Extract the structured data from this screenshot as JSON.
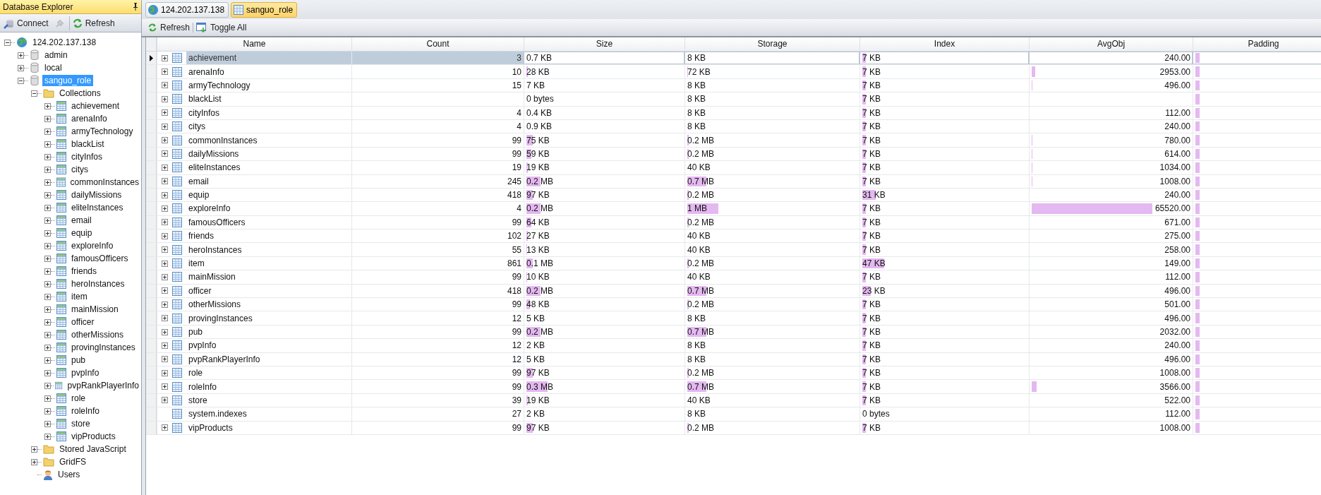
{
  "explorer": {
    "title": "Database Explorer",
    "toolbar": [
      {
        "kind": "connect",
        "label": "Connect"
      },
      {
        "kind": "disconnect",
        "disabled": true
      },
      {
        "kind": "refresh",
        "label": "Refresh"
      }
    ],
    "tree": [
      {
        "label": "124.202.137.138",
        "kind": "server",
        "expanded": true,
        "selected": false,
        "children": [
          {
            "label": "admin",
            "kind": "database",
            "expanded": false,
            "selected": false
          },
          {
            "label": "local",
            "kind": "database",
            "expanded": false,
            "selected": false
          },
          {
            "label": "sanguo_role",
            "kind": "database",
            "expanded": true,
            "selected": true,
            "children": [
              {
                "label": "Collections",
                "kind": "folder",
                "expanded": true,
                "selected": false,
                "children": [
                  {
                    "label": "achievement",
                    "kind": "collection",
                    "expanded": false,
                    "selected": false
                  },
                  {
                    "label": "arenaInfo",
                    "kind": "collection",
                    "expanded": false,
                    "selected": false
                  },
                  {
                    "label": "armyTechnology",
                    "kind": "collection",
                    "expanded": false,
                    "selected": false
                  },
                  {
                    "label": "blackList",
                    "kind": "collection",
                    "expanded": false,
                    "selected": false
                  },
                  {
                    "label": "cityInfos",
                    "kind": "collection",
                    "expanded": false,
                    "selected": false
                  },
                  {
                    "label": "citys",
                    "kind": "collection",
                    "expanded": false,
                    "selected": false
                  },
                  {
                    "label": "commonInstances",
                    "kind": "collection",
                    "expanded": false,
                    "selected": false
                  },
                  {
                    "label": "dailyMissions",
                    "kind": "collection",
                    "expanded": false,
                    "selected": false
                  },
                  {
                    "label": "eliteInstances",
                    "kind": "collection",
                    "expanded": false,
                    "selected": false
                  },
                  {
                    "label": "email",
                    "kind": "collection",
                    "expanded": false,
                    "selected": false
                  },
                  {
                    "label": "equip",
                    "kind": "collection",
                    "expanded": false,
                    "selected": false
                  },
                  {
                    "label": "exploreInfo",
                    "kind": "collection",
                    "expanded": false,
                    "selected": false
                  },
                  {
                    "label": "famousOfficers",
                    "kind": "collection",
                    "expanded": false,
                    "selected": false
                  },
                  {
                    "label": "friends",
                    "kind": "collection",
                    "expanded": false,
                    "selected": false
                  },
                  {
                    "label": "heroInstances",
                    "kind": "collection",
                    "expanded": false,
                    "selected": false
                  },
                  {
                    "label": "item",
                    "kind": "collection",
                    "expanded": false,
                    "selected": false
                  },
                  {
                    "label": "mainMission",
                    "kind": "collection",
                    "expanded": false,
                    "selected": false
                  },
                  {
                    "label": "officer",
                    "kind": "collection",
                    "expanded": false,
                    "selected": false
                  },
                  {
                    "label": "otherMissions",
                    "kind": "collection",
                    "expanded": false,
                    "selected": false
                  },
                  {
                    "label": "provingInstances",
                    "kind": "collection",
                    "expanded": false,
                    "selected": false
                  },
                  {
                    "label": "pub",
                    "kind": "collection",
                    "expanded": false,
                    "selected": false
                  },
                  {
                    "label": "pvpInfo",
                    "kind": "collection",
                    "expanded": false,
                    "selected": false
                  },
                  {
                    "label": "pvpRankPlayerInfo",
                    "kind": "collection",
                    "expanded": false,
                    "selected": false
                  },
                  {
                    "label": "role",
                    "kind": "collection",
                    "expanded": false,
                    "selected": false
                  },
                  {
                    "label": "roleInfo",
                    "kind": "collection",
                    "expanded": false,
                    "selected": false
                  },
                  {
                    "label": "store",
                    "kind": "collection",
                    "expanded": false,
                    "selected": false
                  },
                  {
                    "label": "vipProducts",
                    "kind": "collection",
                    "expanded": false,
                    "selected": false
                  }
                ]
              },
              {
                "label": "Stored JavaScript",
                "kind": "folder",
                "expanded": false,
                "selected": false
              },
              {
                "label": "GridFS",
                "kind": "folder",
                "expanded": false,
                "selected": false
              },
              {
                "label": "Users",
                "kind": "user",
                "selected": false
              }
            ]
          }
        ]
      }
    ]
  },
  "tabs": [
    {
      "label": "124.202.137.138",
      "kind": "server",
      "selected": false
    },
    {
      "label": "sanguo_role",
      "kind": "database",
      "selected": true
    }
  ],
  "toolbar": [
    {
      "kind": "refresh",
      "label": "Refresh"
    },
    {
      "kind": "toggle",
      "label": "Toggle All"
    }
  ],
  "table": {
    "columns": [
      "Name",
      "Count",
      "Size",
      "Storage",
      "Index",
      "AvgObj",
      "Padding"
    ],
    "rows": [
      {
        "name": "achievement",
        "expandable": true,
        "selected": true,
        "count": "3",
        "size": {
          "text": "0.7 KB"
        },
        "storage": {
          "text": "8 KB"
        },
        "index": {
          "text": "7 KB",
          "level": 0.02
        },
        "avgobj": {
          "text": "240.00"
        },
        "padding": {
          "level": 0.03
        }
      },
      {
        "name": "arenaInfo",
        "expandable": true,
        "selected": false,
        "count": "10",
        "size": {
          "text": "28 KB",
          "level": 0.01
        },
        "storage": {
          "text": "72 KB",
          "level": 0.005
        },
        "index": {
          "text": "7 KB",
          "level": 0.02
        },
        "avgobj": {
          "text": "2953.00",
          "level": 0.02
        },
        "padding": {
          "level": 0.03
        }
      },
      {
        "name": "armyTechnology",
        "expandable": true,
        "selected": false,
        "count": "15",
        "size": {
          "text": "7 KB"
        },
        "storage": {
          "text": "8 KB"
        },
        "index": {
          "text": "7 KB",
          "level": 0.02
        },
        "avgobj": {
          "text": "496.00",
          "level": 0.005
        },
        "padding": {
          "level": 0.03
        }
      },
      {
        "name": "blackList",
        "expandable": true,
        "selected": false,
        "size": {
          "text": "0 bytes"
        },
        "storage": {
          "text": "8 KB"
        },
        "index": {
          "text": "7 KB",
          "level": 0.02
        },
        "padding": {
          "level": 0.03
        }
      },
      {
        "name": "cityInfos",
        "expandable": true,
        "selected": false,
        "count": "4",
        "size": {
          "text": "0.4 KB"
        },
        "storage": {
          "text": "8 KB"
        },
        "index": {
          "text": "7 KB",
          "level": 0.02
        },
        "avgobj": {
          "text": "112.00"
        },
        "padding": {
          "level": 0.03
        }
      },
      {
        "name": "citys",
        "expandable": true,
        "selected": false,
        "count": "4",
        "size": {
          "text": "0.9 KB"
        },
        "storage": {
          "text": "8 KB"
        },
        "index": {
          "text": "7 KB",
          "level": 0.02
        },
        "avgobj": {
          "text": "240.00"
        },
        "padding": {
          "level": 0.03
        }
      },
      {
        "name": "commonInstances",
        "expandable": true,
        "selected": false,
        "count": "99",
        "size": {
          "text": "75 KB",
          "level": 0.04
        },
        "storage": {
          "text": "0.2 MB",
          "level": 0.01
        },
        "index": {
          "text": "7 KB",
          "level": 0.02
        },
        "avgobj": {
          "text": "780.00",
          "level": 0.005
        },
        "padding": {
          "level": 0.03
        }
      },
      {
        "name": "dailyMissions",
        "expandable": true,
        "selected": false,
        "count": "99",
        "size": {
          "text": "59 KB",
          "level": 0.03
        },
        "storage": {
          "text": "0.2 MB",
          "level": 0.01
        },
        "index": {
          "text": "7 KB",
          "level": 0.02
        },
        "avgobj": {
          "text": "614.00",
          "level": 0.005
        },
        "padding": {
          "level": 0.03
        }
      },
      {
        "name": "eliteInstances",
        "expandable": true,
        "selected": false,
        "count": "19",
        "size": {
          "text": "19 KB",
          "level": 0.01
        },
        "storage": {
          "text": "40 KB"
        },
        "index": {
          "text": "7 KB",
          "level": 0.02
        },
        "avgobj": {
          "text": "1034.00",
          "level": 0.005
        },
        "padding": {
          "level": 0.03
        }
      },
      {
        "name": "email",
        "expandable": true,
        "selected": false,
        "count": "245",
        "size": {
          "text": "0.2 MB",
          "level": 0.09
        },
        "storage": {
          "text": "0.7 MB",
          "level": 0.11
        },
        "index": {
          "text": "7 KB",
          "level": 0.02
        },
        "avgobj": {
          "text": "1008.00",
          "level": 0.005
        },
        "padding": {
          "level": 0.03
        }
      },
      {
        "name": "equip",
        "expandable": true,
        "selected": false,
        "count": "418",
        "size": {
          "text": "97 KB",
          "level": 0.04
        },
        "storage": {
          "text": "0.2 MB",
          "level": 0.01
        },
        "index": {
          "text": "31 KB",
          "level": 0.08
        },
        "avgobj": {
          "text": "240.00"
        },
        "padding": {
          "level": 0.03
        }
      },
      {
        "name": "exploreInfo",
        "expandable": true,
        "selected": false,
        "count": "4",
        "size": {
          "text": "0.2 MB",
          "level": 0.09
        },
        "storage": {
          "text": "1 MB",
          "level": 0.18
        },
        "index": {
          "text": "7 KB",
          "level": 0.02
        },
        "avgobj": {
          "text": "65520.00",
          "level": 0.74
        },
        "padding": {
          "level": 0.03
        }
      },
      {
        "name": "famousOfficers",
        "expandable": true,
        "selected": false,
        "count": "99",
        "size": {
          "text": "64 KB",
          "level": 0.03
        },
        "storage": {
          "text": "0.2 MB",
          "level": 0.01
        },
        "index": {
          "text": "7 KB",
          "level": 0.02
        },
        "avgobj": {
          "text": "671.00"
        },
        "padding": {
          "level": 0.03
        }
      },
      {
        "name": "friends",
        "expandable": true,
        "selected": false,
        "count": "102",
        "size": {
          "text": "27 KB",
          "level": 0.01
        },
        "storage": {
          "text": "40 KB"
        },
        "index": {
          "text": "7 KB",
          "level": 0.02
        },
        "avgobj": {
          "text": "275.00"
        },
        "padding": {
          "level": 0.03
        }
      },
      {
        "name": "heroInstances",
        "expandable": true,
        "selected": false,
        "count": "55",
        "size": {
          "text": "13 KB",
          "level": 0.005
        },
        "storage": {
          "text": "40 KB"
        },
        "index": {
          "text": "7 KB",
          "level": 0.02
        },
        "avgobj": {
          "text": "258.00"
        },
        "padding": {
          "level": 0.03
        }
      },
      {
        "name": "item",
        "expandable": true,
        "selected": false,
        "count": "861",
        "size": {
          "text": "0.1 MB",
          "level": 0.04
        },
        "storage": {
          "text": "0.2 MB",
          "level": 0.01
        },
        "index": {
          "text": "47 KB",
          "level": 0.13
        },
        "avgobj": {
          "text": "149.00"
        },
        "padding": {
          "level": 0.03
        }
      },
      {
        "name": "mainMission",
        "expandable": true,
        "selected": false,
        "count": "99",
        "size": {
          "text": "10 KB",
          "level": 0.005
        },
        "storage": {
          "text": "40 KB"
        },
        "index": {
          "text": "7 KB",
          "level": 0.02
        },
        "avgobj": {
          "text": "112.00"
        },
        "padding": {
          "level": 0.03
        }
      },
      {
        "name": "officer",
        "expandable": true,
        "selected": false,
        "count": "418",
        "size": {
          "text": "0.2 MB",
          "level": 0.09
        },
        "storage": {
          "text": "0.7 MB",
          "level": 0.11
        },
        "index": {
          "text": "23 KB",
          "level": 0.05
        },
        "avgobj": {
          "text": "496.00"
        },
        "padding": {
          "level": 0.03
        }
      },
      {
        "name": "otherMissions",
        "expandable": true,
        "selected": false,
        "count": "99",
        "size": {
          "text": "48 KB",
          "level": 0.02
        },
        "storage": {
          "text": "0.2 MB",
          "level": 0.01
        },
        "index": {
          "text": "7 KB",
          "level": 0.02
        },
        "avgobj": {
          "text": "501.00"
        },
        "padding": {
          "level": 0.03
        }
      },
      {
        "name": "provingInstances",
        "expandable": true,
        "selected": false,
        "count": "12",
        "size": {
          "text": "5 KB"
        },
        "storage": {
          "text": "8 KB"
        },
        "index": {
          "text": "7 KB",
          "level": 0.02
        },
        "avgobj": {
          "text": "496.00"
        },
        "padding": {
          "level": 0.03
        }
      },
      {
        "name": "pub",
        "expandable": true,
        "selected": false,
        "count": "99",
        "size": {
          "text": "0.2 MB",
          "level": 0.09
        },
        "storage": {
          "text": "0.7 MB",
          "level": 0.11
        },
        "index": {
          "text": "7 KB",
          "level": 0.02
        },
        "avgobj": {
          "text": "2032.00"
        },
        "padding": {
          "level": 0.03
        }
      },
      {
        "name": "pvpInfo",
        "expandable": true,
        "selected": false,
        "count": "12",
        "size": {
          "text": "2 KB"
        },
        "storage": {
          "text": "8 KB"
        },
        "index": {
          "text": "7 KB",
          "level": 0.02
        },
        "avgobj": {
          "text": "240.00"
        },
        "padding": {
          "level": 0.03
        }
      },
      {
        "name": "pvpRankPlayerInfo",
        "expandable": true,
        "selected": false,
        "count": "12",
        "size": {
          "text": "5 KB"
        },
        "storage": {
          "text": "8 KB"
        },
        "index": {
          "text": "7 KB",
          "level": 0.02
        },
        "avgobj": {
          "text": "496.00"
        },
        "padding": {
          "level": 0.03
        }
      },
      {
        "name": "role",
        "expandable": true,
        "selected": false,
        "count": "99",
        "size": {
          "text": "97 KB",
          "level": 0.04
        },
        "storage": {
          "text": "0.2 MB",
          "level": 0.01
        },
        "index": {
          "text": "7 KB",
          "level": 0.02
        },
        "avgobj": {
          "text": "1008.00"
        },
        "padding": {
          "level": 0.03
        }
      },
      {
        "name": "roleInfo",
        "expandable": true,
        "selected": false,
        "count": "99",
        "size": {
          "text": "0.3 MB",
          "level": 0.13
        },
        "storage": {
          "text": "0.7 MB",
          "level": 0.11
        },
        "index": {
          "text": "7 KB",
          "level": 0.02
        },
        "avgobj": {
          "text": "3566.00",
          "level": 0.03
        },
        "padding": {
          "level": 0.03
        }
      },
      {
        "name": "store",
        "expandable": true,
        "selected": false,
        "count": "39",
        "size": {
          "text": "19 KB",
          "level": 0.01
        },
        "storage": {
          "text": "40 KB"
        },
        "index": {
          "text": "7 KB",
          "level": 0.02
        },
        "avgobj": {
          "text": "522.00"
        },
        "padding": {
          "level": 0.03
        }
      },
      {
        "name": "system.indexes",
        "expandable": false,
        "selected": false,
        "count": "27",
        "size": {
          "text": "2 KB"
        },
        "storage": {
          "text": "8 KB"
        },
        "index": {
          "text": "0 bytes"
        },
        "avgobj": {
          "text": "112.00"
        },
        "padding": {
          "level": 0.03
        }
      },
      {
        "name": "vipProducts",
        "expandable": true,
        "selected": false,
        "count": "99",
        "size": {
          "text": "97 KB",
          "level": 0.04
        },
        "storage": {
          "text": "0.2 MB",
          "level": 0.01
        },
        "index": {
          "text": "7 KB",
          "level": 0.02
        },
        "avgobj": {
          "text": "1008.00"
        },
        "padding": {
          "level": 0.03
        }
      }
    ]
  }
}
